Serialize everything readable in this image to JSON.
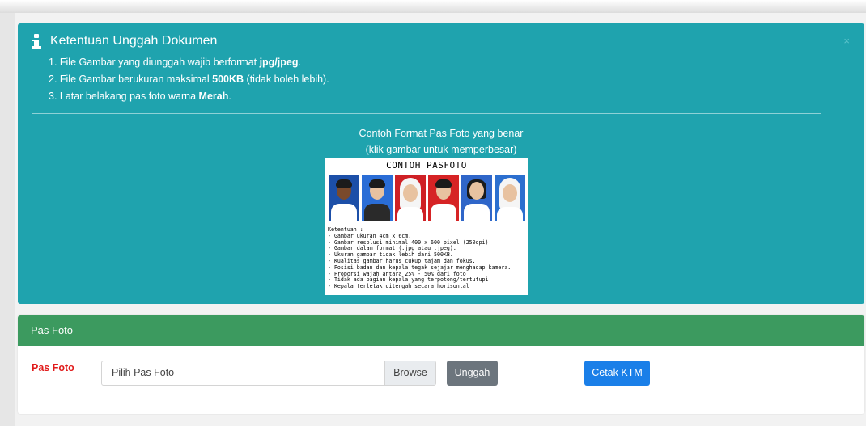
{
  "alert": {
    "title": "Ketentuan Unggah Dokumen",
    "close": "×",
    "rules": [
      {
        "pre": "1. File Gambar yang diunggah wajib berformat ",
        "bold": "jpg/jpeg",
        "post": "."
      },
      {
        "pre": "2. File Gambar berukuran maksimal ",
        "bold": "500KB",
        "post": " (tidak boleh lebih)."
      },
      {
        "pre": "3. Latar belakang pas foto warna ",
        "bold": "Merah",
        "post": "."
      }
    ],
    "sample_title": "Contoh Format Pas Foto yang benar",
    "sample_hint": "(klik gambar untuk memperbesar)"
  },
  "sample_image": {
    "title": "CONTOH PASFOTO",
    "backgrounds": [
      "#1c4fa8",
      "#2a6dd6",
      "#cf2025",
      "#d62325",
      "#2f66c9",
      "#2b6fcf"
    ],
    "rules": "Ketentuan :\n- Gambar ukuran 4cm x 6cm.\n- Gambar resolusi minimal 400 x 600 pixel (250dpi).\n- Gambar dalam format (.jpg atau .jpeg).\n- Ukuran gambar tidak lebih dari 500KB.\n- Kualitas gambar harus cukup tajam dan fokus.\n- Posisi badan dan kepala tegak sejajar menghadap kamera.\n- Proporsi wajah antara 25% - 50% dari foto\n- Tidak ada bagian kepala yang terpotong/tertutupi.\n- Kepala terletak ditengah secara horisontal"
  },
  "panel": {
    "title": "Pas Foto",
    "field_label": "Pas Foto",
    "file_placeholder": "Pilih Pas Foto",
    "browse_label": "Browse",
    "upload_label": "Unggah",
    "print_label": "Cetak KTM"
  },
  "colors": {
    "alert_bg": "#1fa3ae",
    "panel_header": "#3c9a5f",
    "required_label": "#e11b1b",
    "primary_button": "#1a7fe8",
    "secondary_button": "#6c757d"
  }
}
